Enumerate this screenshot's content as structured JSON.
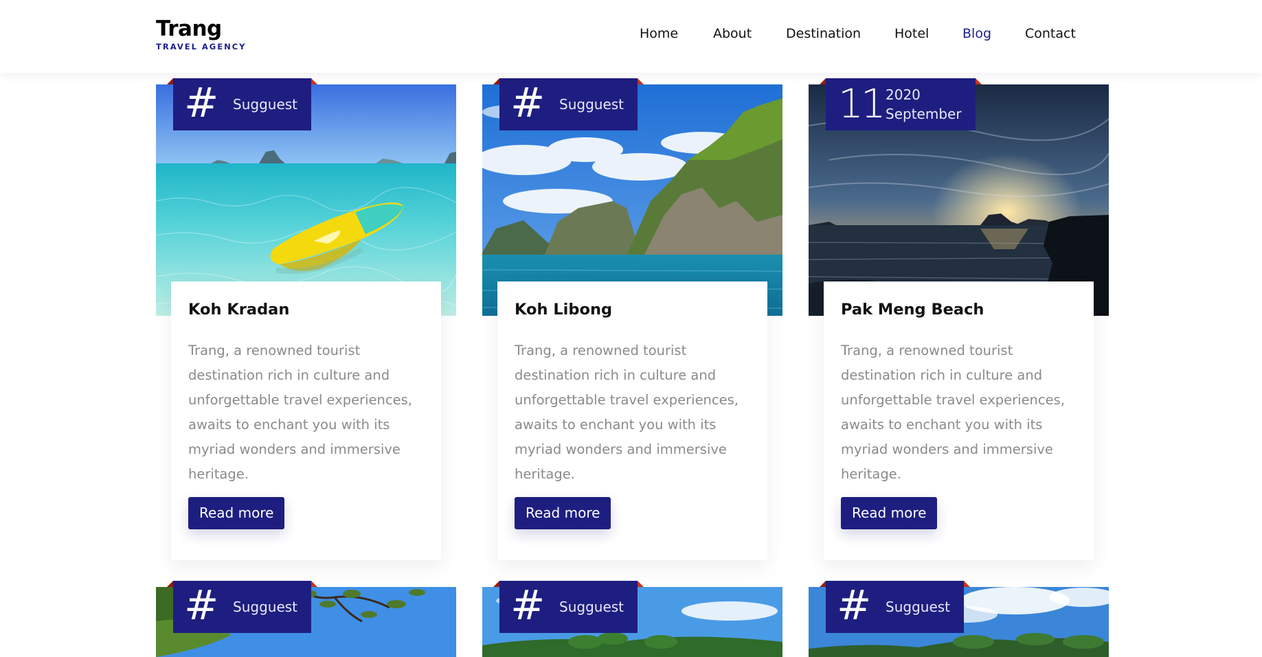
{
  "brand": {
    "name": "Trang",
    "tagline": "TRAVEL AGENCY",
    "accent_color": "#1e1e80"
  },
  "nav": {
    "items": [
      {
        "label": "Home",
        "active": false
      },
      {
        "label": "About",
        "active": false
      },
      {
        "label": "Destination",
        "active": false
      },
      {
        "label": "Hotel",
        "active": false
      },
      {
        "label": "Blog",
        "active": true
      },
      {
        "label": "Contact",
        "active": false
      }
    ]
  },
  "cards": [
    {
      "tag_icon": "#",
      "tag_label": "Sugguest",
      "image": "kayak-clear-water",
      "title": "Koh Kradan",
      "description": "Trang, a renowned tourist destination rich in culture and unforgettable travel experiences, awaits to enchant you with its myriad wonders and immersive heritage.",
      "button": "Read more"
    },
    {
      "tag_icon": "#",
      "tag_label": "Sugguest",
      "image": "limestone-cliffs-sea",
      "title": "Koh Libong",
      "description": "Trang, a renowned tourist destination rich in culture and unforgettable travel experiences, awaits to enchant you with its myriad wonders and immersive heritage.",
      "button": "Read more"
    },
    {
      "date": {
        "day": "11",
        "year": "2020",
        "month": "September"
      },
      "image": "sunset-beach",
      "title": "Pak Meng Beach",
      "description": "Trang, a renowned tourist destination rich in culture and unforgettable travel experiences, awaits to enchant you with its myriad wonders and immersive heritage.",
      "button": "Read more"
    }
  ],
  "cards_row2": [
    {
      "tag_icon": "#",
      "tag_label": "Sugguest",
      "image": "tree-branches-sky"
    },
    {
      "tag_icon": "#",
      "tag_label": "Sugguest",
      "image": "island-palms"
    },
    {
      "tag_icon": "#",
      "tag_label": "Sugguest",
      "image": "green-hills-clouds"
    }
  ]
}
